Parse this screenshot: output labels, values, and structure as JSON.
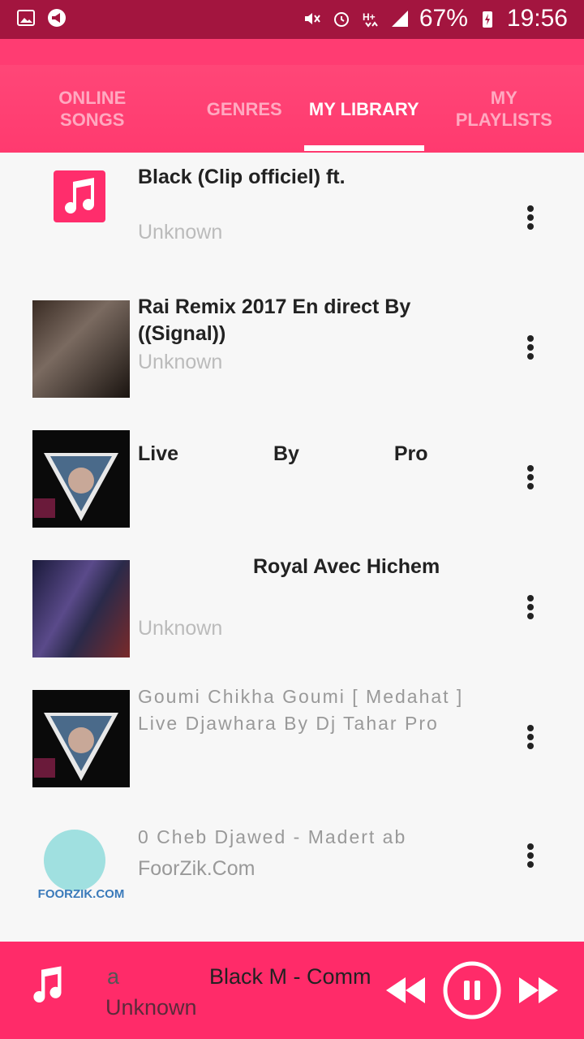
{
  "status": {
    "battery": "67%",
    "time": "19:56"
  },
  "tabs": [
    {
      "label": "ONLINE SONGS",
      "active": false
    },
    {
      "label": "GENRES",
      "active": false
    },
    {
      "label": "MY LIBRARY",
      "active": true
    },
    {
      "label": "MY PLAYLISTS",
      "active": false
    }
  ],
  "songs": [
    {
      "title": "Black (Clip officiel) ft.",
      "subtitle": "Unknown"
    },
    {
      "title": "Rai Remix 2017 En direct By ((Signal))",
      "subtitle": "Unknown"
    },
    {
      "title": "Live By Pro",
      "subtitle": ""
    },
    {
      "title": "Royal Avec Hichem",
      "subtitle": "Unknown"
    },
    {
      "title": "Goumi Chikha Goumi [ Medahat ] Live Djawhara By Dj Tahar Pro",
      "subtitle": ""
    },
    {
      "title": "0 Cheb Djawed - Madert ab",
      "subtitle": "FoorZik.Com"
    }
  ],
  "player": {
    "prefix": "a",
    "title": "Black M - Comm",
    "artist": "Unknown"
  },
  "colors": {
    "statusbar": "#a3153f",
    "accent": "#ff2b69",
    "tab_bg": "#ff4475"
  }
}
